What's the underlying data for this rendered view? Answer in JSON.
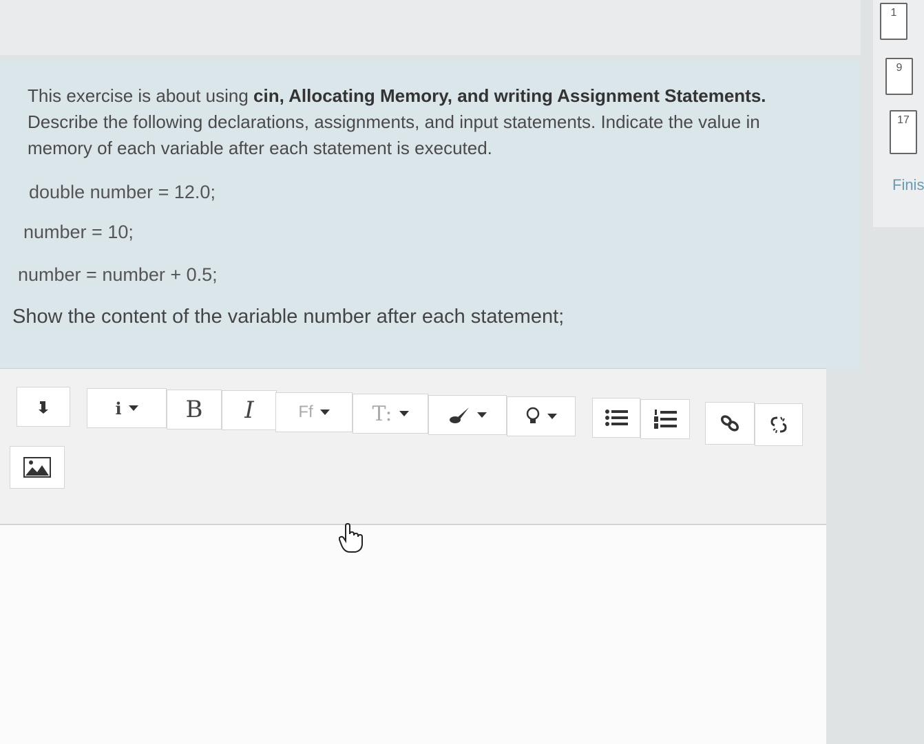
{
  "question": {
    "intro_plain": "This exercise is about using ",
    "intro_bold": "cin, Allocating Memory, and writing Assignment Statements.",
    "intro_rest": " Describe the following declarations, assignments, and input statements. Indicate the value in memory of each variable after each statement is executed.",
    "code_lines": [
      "double number = 12.0;",
      "number = 10;",
      "number = number + 0.5;"
    ],
    "prompt": "Show the content of the variable number after each statement;"
  },
  "nav": {
    "items": [
      "1",
      "9",
      "17"
    ],
    "finish_label": "Finis"
  },
  "toolbar": {
    "expand_icon": "collapse-arrow-icon",
    "info_label": "i",
    "bold_label": "B",
    "italic_label": "I",
    "font_family_label": "Ff",
    "font_size_label": "T:",
    "color_icon": "brush-icon",
    "highlight_icon": "lightbulb-icon",
    "unordered_list_icon": "bullet-list-icon",
    "ordered_list_icon": "numbered-list-icon",
    "link_icon": "link-icon",
    "unlink_icon": "unlink-icon",
    "image_icon": "image-icon"
  },
  "editor": {
    "content": ""
  }
}
